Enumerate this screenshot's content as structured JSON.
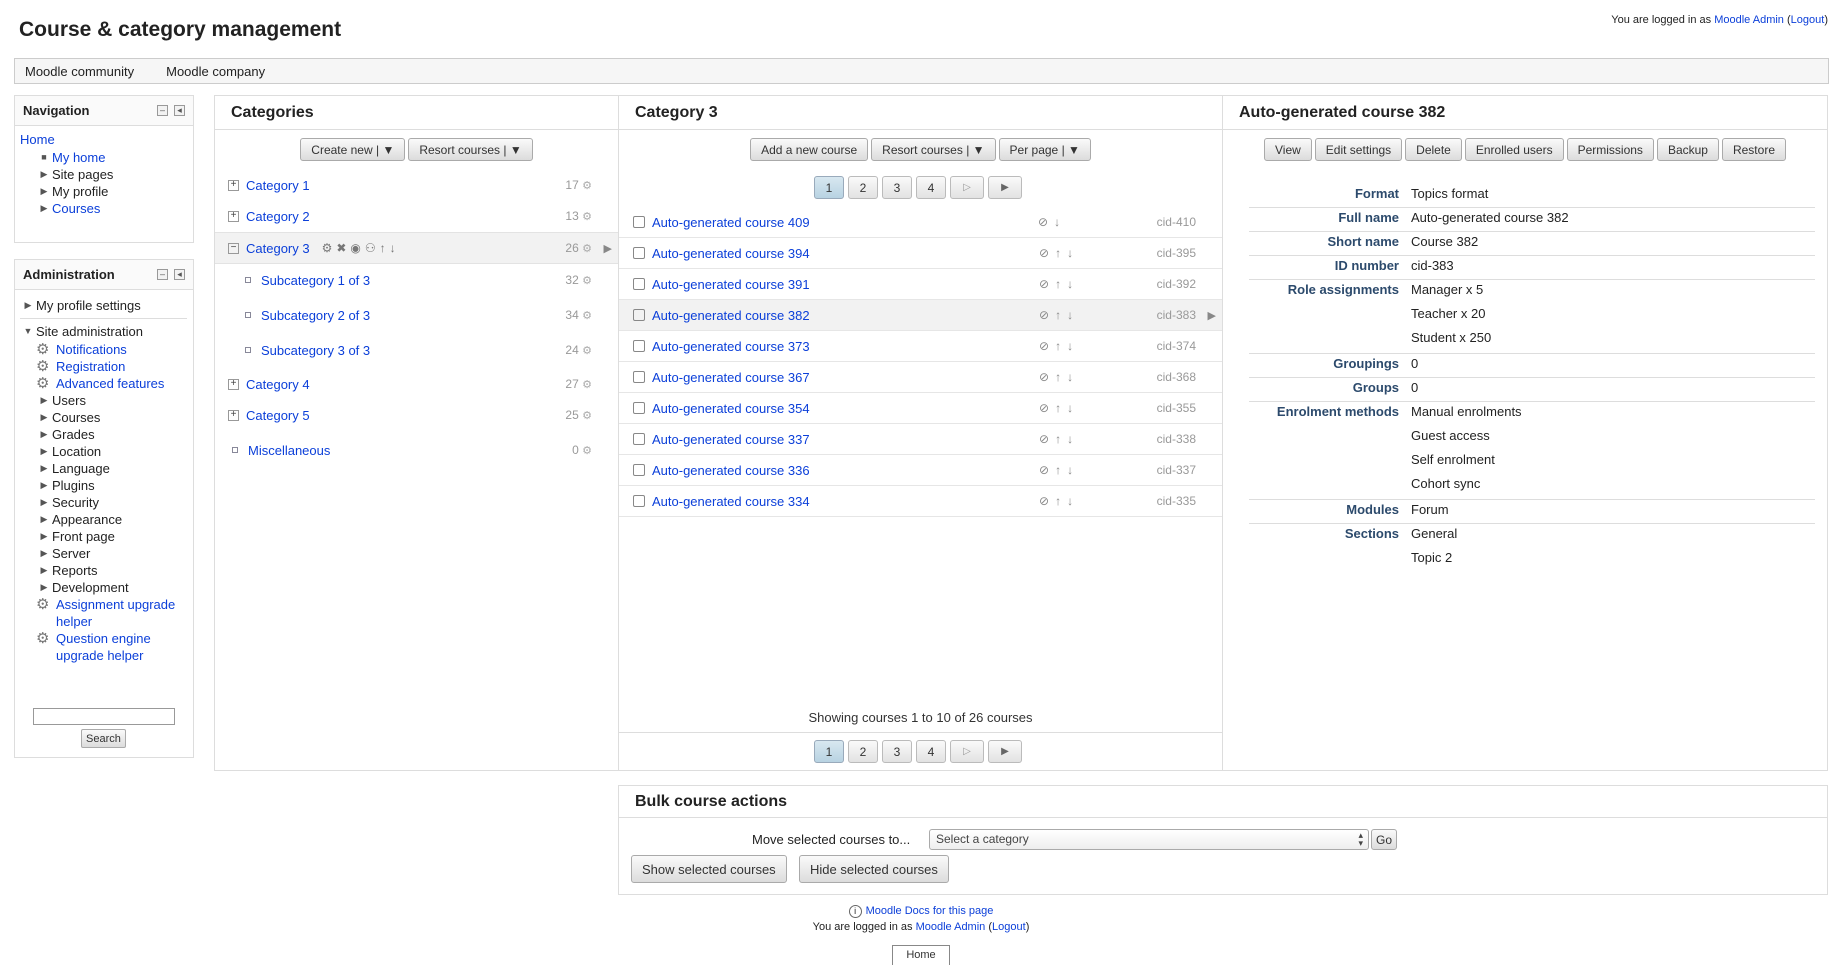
{
  "header": {
    "title": "Course & category management",
    "login_prefix": "You are logged in as ",
    "user_name": "Moodle Admin",
    "logout": "Logout"
  },
  "custom_menu": [
    "Moodle community",
    "Moodle company"
  ],
  "navigation": {
    "title": "Navigation",
    "home": "Home",
    "items": [
      "My home",
      "Site pages",
      "My profile",
      "Courses"
    ]
  },
  "administration": {
    "title": "Administration",
    "profile_settings": "My profile settings",
    "site_admin": "Site administration",
    "link_items": [
      "Notifications",
      "Registration",
      "Advanced features"
    ],
    "folder_items": [
      "Users",
      "Courses",
      "Grades",
      "Location",
      "Language",
      "Plugins",
      "Security",
      "Appearance",
      "Front page",
      "Server",
      "Reports",
      "Development"
    ],
    "bottom_links": [
      "Assignment upgrade helper",
      "Question engine upgrade helper"
    ],
    "search_button": "Search",
    "search_value": ""
  },
  "categories_panel": {
    "title": "Categories",
    "create_new": "Create new",
    "resort": "Resort courses",
    "rows": [
      {
        "name": "Category 1",
        "count": "17"
      },
      {
        "name": "Category 2",
        "count": "13"
      },
      {
        "name": "Category 3",
        "count": "26"
      },
      {
        "name": "Subcategory 1 of 3",
        "count": "32"
      },
      {
        "name": "Subcategory 2 of 3",
        "count": "34"
      },
      {
        "name": "Subcategory 3 of 3",
        "count": "24"
      },
      {
        "name": "Category 4",
        "count": "27"
      },
      {
        "name": "Category 5",
        "count": "25"
      },
      {
        "name": "Miscellaneous",
        "count": "0"
      }
    ]
  },
  "courses_panel": {
    "title": "Category 3",
    "add_course": "Add a new course",
    "resort": "Resort courses",
    "per_page": "Per page",
    "pages": [
      "1",
      "2",
      "3",
      "4"
    ],
    "courses": [
      {
        "name": "Auto-generated course 409",
        "id": "cid-410"
      },
      {
        "name": "Auto-generated course 394",
        "id": "cid-395"
      },
      {
        "name": "Auto-generated course 391",
        "id": "cid-392"
      },
      {
        "name": "Auto-generated course 382",
        "id": "cid-383"
      },
      {
        "name": "Auto-generated course 373",
        "id": "cid-374"
      },
      {
        "name": "Auto-generated course 367",
        "id": "cid-368"
      },
      {
        "name": "Auto-generated course 354",
        "id": "cid-355"
      },
      {
        "name": "Auto-generated course 337",
        "id": "cid-338"
      },
      {
        "name": "Auto-generated course 336",
        "id": "cid-337"
      },
      {
        "name": "Auto-generated course 334",
        "id": "cid-335"
      }
    ],
    "showing": "Showing courses 1 to 10 of 26 courses"
  },
  "detail_panel": {
    "title": "Auto-generated course 382",
    "buttons": [
      "View",
      "Edit settings",
      "Delete",
      "Enrolled users",
      "Permissions",
      "Backup",
      "Restore"
    ],
    "labels": {
      "format": "Format",
      "fullname": "Full name",
      "shortname": "Short name",
      "idnumber": "ID number",
      "roles": "Role assignments",
      "groupings": "Groupings",
      "groups": "Groups",
      "enrol": "Enrolment methods",
      "modules": "Modules",
      "sections": "Sections"
    },
    "values": {
      "format": "Topics format",
      "fullname": "Auto-generated course 382",
      "shortname": "Course 382",
      "idnumber": "cid-383",
      "roles": [
        "Manager x 5",
        "Teacher x 20",
        "Student x 250"
      ],
      "groupings": "0",
      "groups": "0",
      "enrol": [
        "Manual enrolments",
        "Guest access",
        "Self enrolment",
        "Cohort sync"
      ],
      "modules": "Forum",
      "sections": [
        "General",
        "Topic 2"
      ]
    }
  },
  "bulk": {
    "title": "Bulk course actions",
    "move_label": "Move selected courses to...",
    "select_placeholder": "Select a category",
    "go": "Go",
    "show": "Show selected courses",
    "hide": "Hide selected courses"
  },
  "footer": {
    "docs": "Moodle Docs for this page",
    "login_prefix": "You are logged in as ",
    "user_name": "Moodle Admin",
    "logout": "Logout",
    "home": "Home"
  }
}
